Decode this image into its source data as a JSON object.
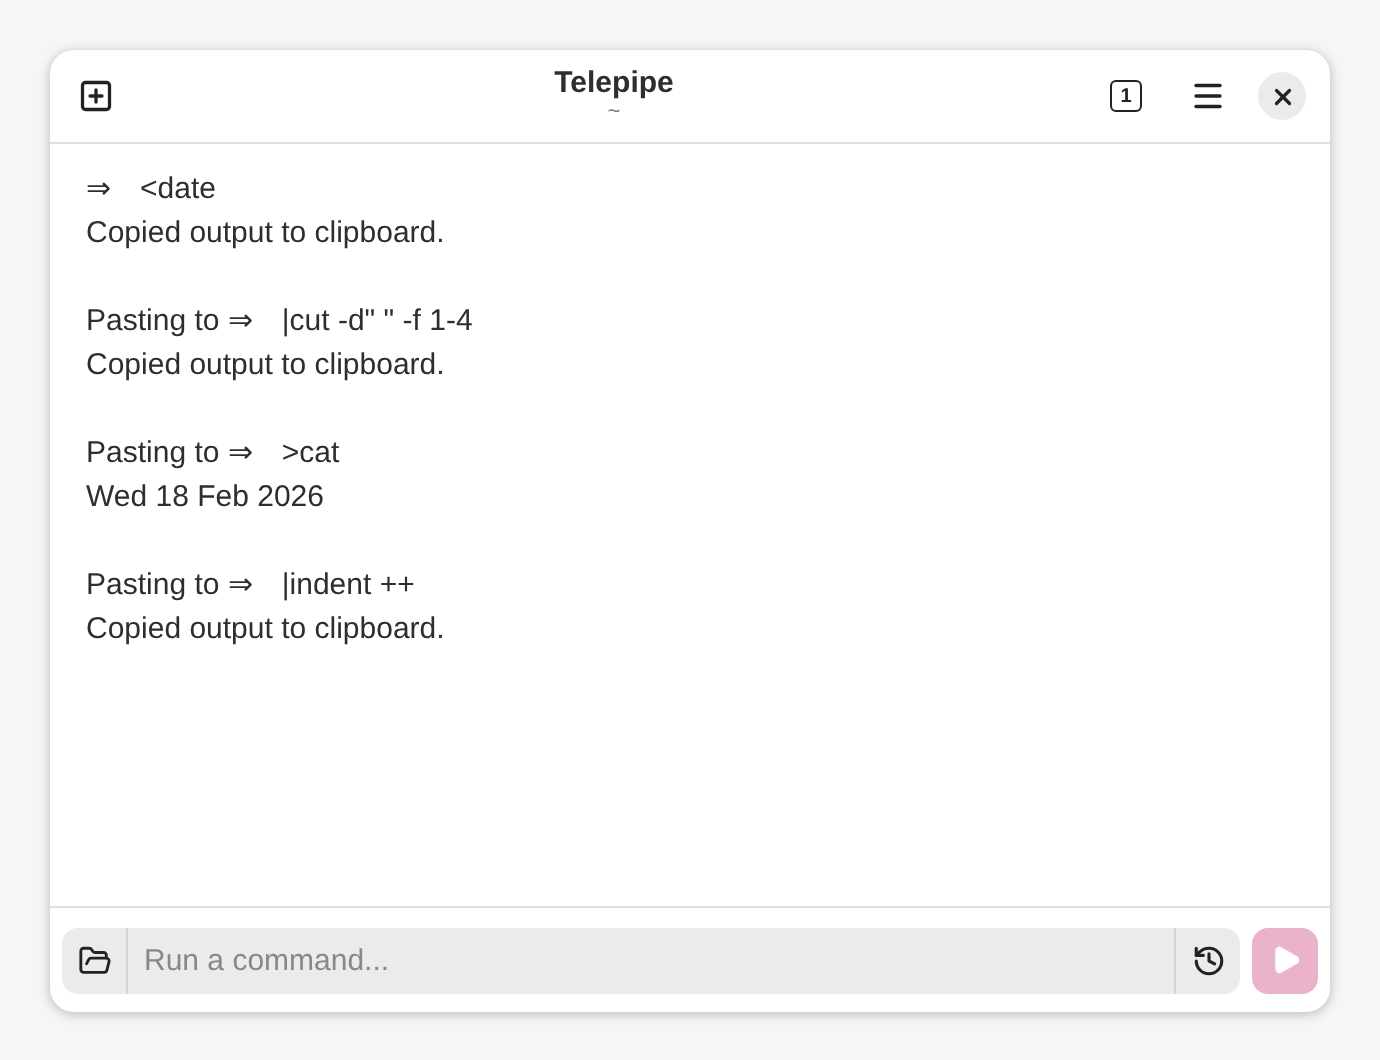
{
  "window": {
    "title": "Telepipe",
    "subtitle": "~",
    "tab_count": "1"
  },
  "entries": [
    {
      "prefix": "⇒",
      "command": "<date",
      "output": "Copied output to clipboard."
    },
    {
      "prefix": "Pasting to ⇒",
      "command": "|cut -d\" \" -f 1-4",
      "output": "Copied output to clipboard."
    },
    {
      "prefix": "Pasting to ⇒",
      "command": ">cat",
      "output": "Wed 18 Feb 2026"
    },
    {
      "prefix": "Pasting to ⇒",
      "command": "|indent ++",
      "output": "Copied output to clipboard."
    }
  ],
  "command_bar": {
    "placeholder": "Run a command...",
    "run_disabled": true
  }
}
